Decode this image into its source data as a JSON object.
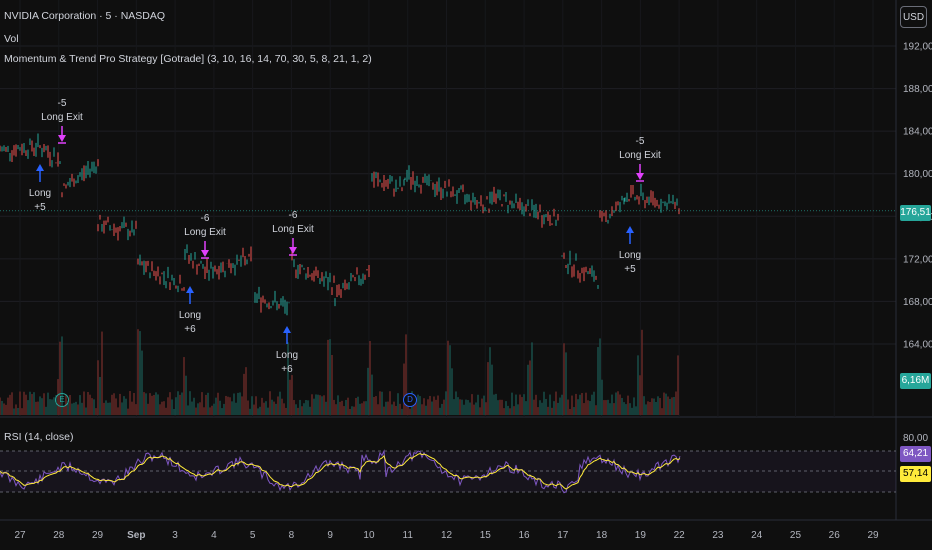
{
  "header": {
    "symbol_line": "NVIDIA Corporation · 5 · NASDAQ",
    "volume_label": "Vol",
    "strategy_label": "Momentum & Trend Pro Strategy [Gotrade] (3, 10, 16, 14, 70, 30, 5, 8, 21, 1, 2)",
    "rsi_label": "RSI (14, close)",
    "currency": "USD"
  },
  "price_axis": {
    "ticks": [
      "192,00",
      "188,00",
      "184,00",
      "180,00",
      "176,00",
      "172,00",
      "168,00",
      "164,00"
    ],
    "current_price": "176,51",
    "volume_value": "6,16M"
  },
  "rsi_axis": {
    "top_tick": "80,00",
    "rsi_value": "64,21",
    "signal_value": "57,14"
  },
  "time_axis": {
    "labels": [
      "27",
      "28",
      "29",
      "Sep",
      "3",
      "4",
      "5",
      "8",
      "9",
      "10",
      "11",
      "12",
      "15",
      "16",
      "17",
      "18",
      "19",
      "22",
      "23",
      "24",
      "25",
      "26",
      "29"
    ]
  },
  "trades": [
    {
      "type": "entry",
      "label": "Long",
      "qty": "+5"
    },
    {
      "type": "exit",
      "label": "Long Exit",
      "qty": "-5"
    },
    {
      "type": "entry",
      "label": "Long",
      "qty": "+6"
    },
    {
      "type": "exit",
      "label": "Long Exit",
      "qty": "-6"
    },
    {
      "type": "entry",
      "label": "Long",
      "qty": "+6"
    },
    {
      "type": "exit",
      "label": "Long Exit",
      "qty": "-6"
    },
    {
      "type": "entry",
      "label": "Long",
      "qty": "+5"
    },
    {
      "type": "exit",
      "label": "Long Exit",
      "qty": "-5"
    }
  ],
  "events": {
    "earnings": "E",
    "dividend": "D"
  },
  "colors": {
    "background": "#0f0f0f",
    "up": "#26a69a",
    "down": "#ef5350",
    "entry_arrow": "#2962ff",
    "exit_arrow": "#e040fb",
    "rsi_line": "#7e57c2",
    "rsi_signal": "#ffeb3b",
    "price_tag": "#26a69a",
    "rsi_tag": "#7e57c2",
    "signal_tag": "#ffeb3b"
  }
}
